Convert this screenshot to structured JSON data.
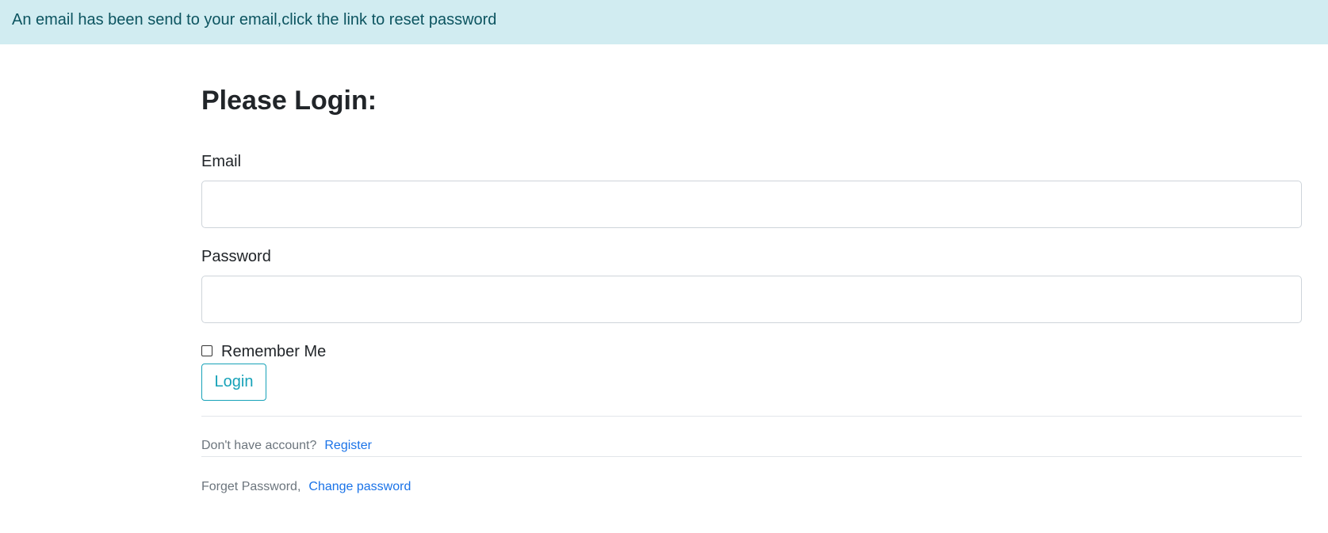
{
  "alert": {
    "message": "An email has been send to your email,click the link to reset password"
  },
  "form": {
    "title": "Please Login:",
    "email_label": "Email",
    "email_value": "",
    "password_label": "Password",
    "password_value": "",
    "remember_label": "Remember Me",
    "remember_checked": false,
    "login_label": "Login"
  },
  "footer": {
    "register_prompt": "Don't have account?",
    "register_link": "Register",
    "forget_prompt": "Forget Password,",
    "change_link": "Change password"
  },
  "colors": {
    "alert_bg": "#d1ecf1",
    "alert_text": "#0c5460",
    "button_accent": "#17a2b8",
    "link": "#1a73e8"
  }
}
